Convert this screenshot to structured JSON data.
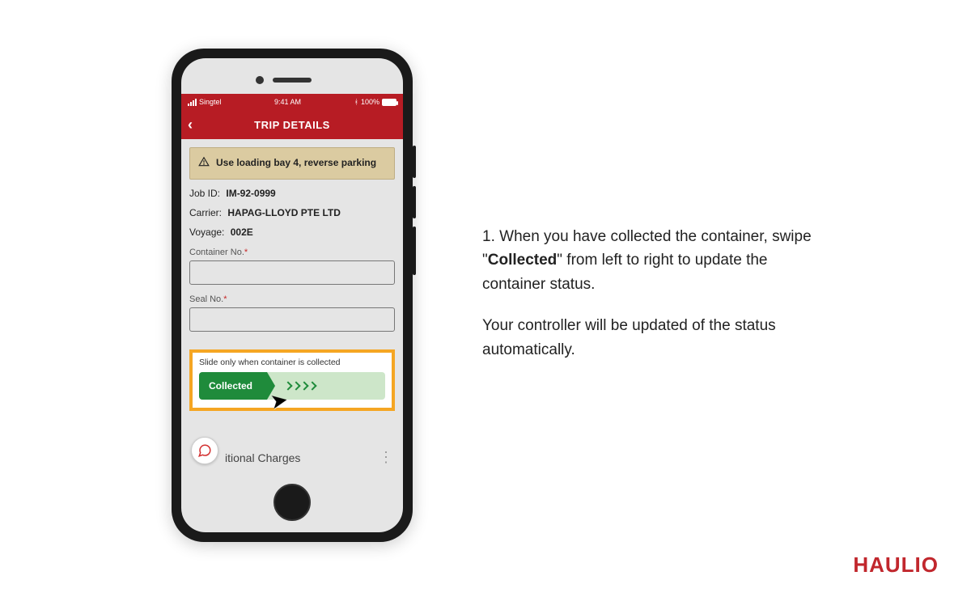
{
  "phone": {
    "status": {
      "carrier": "Singtel",
      "time": "9:41 AM",
      "battery": "100%"
    },
    "title": "TRIP DETAILS",
    "notice": "Use loading bay 4, reverse parking",
    "details": {
      "job_id_label": "Job ID:",
      "job_id": "IM-92-0999",
      "carrier_label": "Carrier:",
      "carrier": "HAPAG-LLOYD PTE LTD",
      "voyage_label": "Voyage:",
      "voyage": "002E"
    },
    "fields": {
      "container_label": "Container No.",
      "seal_label": "Seal No."
    },
    "slider": {
      "hint": "Slide only when container is collected",
      "button": "Collected"
    },
    "bottom_item": "itional Charges"
  },
  "instructions": {
    "step_number": "1.",
    "line1_a": "When you have collected the container, swipe \"",
    "line1_bold": "Collected",
    "line1_b": "\" from left to right to update the container status.",
    "line2": "Your controller will be updated of the status automatically."
  },
  "brand": "HAULIO"
}
